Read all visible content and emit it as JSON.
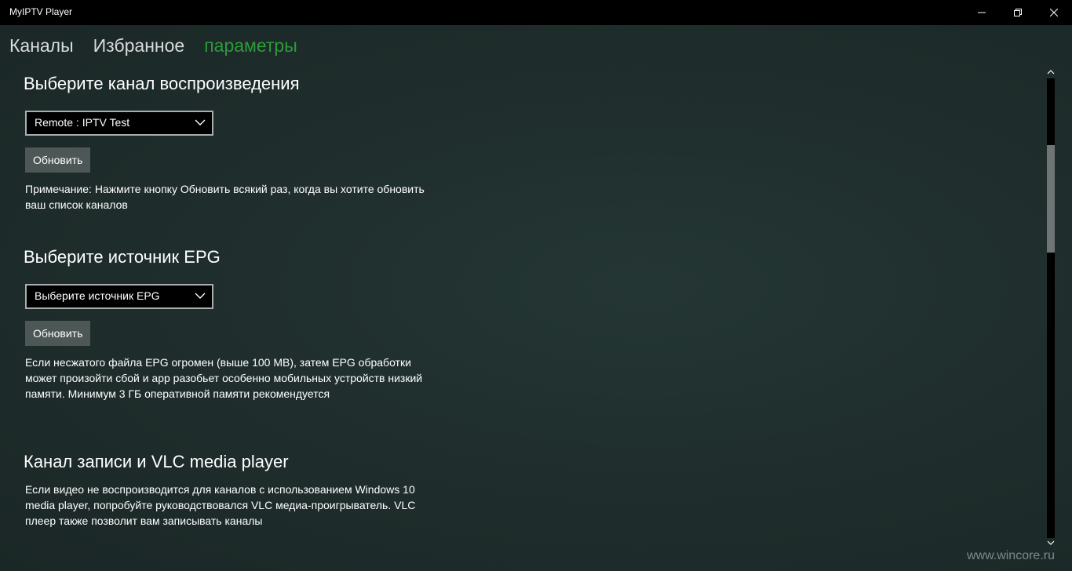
{
  "window": {
    "title": "MyIPTV Player"
  },
  "nav": {
    "tabs": [
      {
        "label": "Каналы",
        "active": false
      },
      {
        "label": "Избранное",
        "active": false
      },
      {
        "label": "параметры",
        "active": true
      }
    ]
  },
  "playback": {
    "heading": "Выберите канал воспроизведения",
    "select_value": "Remote : IPTV Test",
    "refresh_label": "Обновить",
    "note": "Примечание: Нажмите кнопку Обновить всякий раз, когда вы хотите обновить ваш список каналов"
  },
  "epg": {
    "heading": "Выберите источник EPG",
    "select_value": "Выберите источник EPG",
    "refresh_label": "Обновить",
    "note": "Если несжатого файла EPG огромен (выше 100 MB), затем EPG обработки может произойти сбой и app разобьет особенно мобильных устройств низкий памяти. Минимум 3 ГБ оперативной памяти рекомендуется"
  },
  "vlc": {
    "heading": "Канал записи и VLC media player",
    "note": "Если видео не воспроизводится для каналов с использованием Windows 10 media player, попробуйте руководствовался VLC медиа-проигрыватель. VLC плеер также позволит вам записывать каналы"
  },
  "watermark": "www.wincore.ru",
  "colors": {
    "accent": "#2d9b3a",
    "background": "#1f2f2d",
    "button": "#4c5756",
    "titlebar": "#000000"
  },
  "icons": {
    "minimize": "minimize-icon",
    "maximize": "restore-icon",
    "close": "close-icon",
    "dropdown": "chevron-down-icon"
  }
}
